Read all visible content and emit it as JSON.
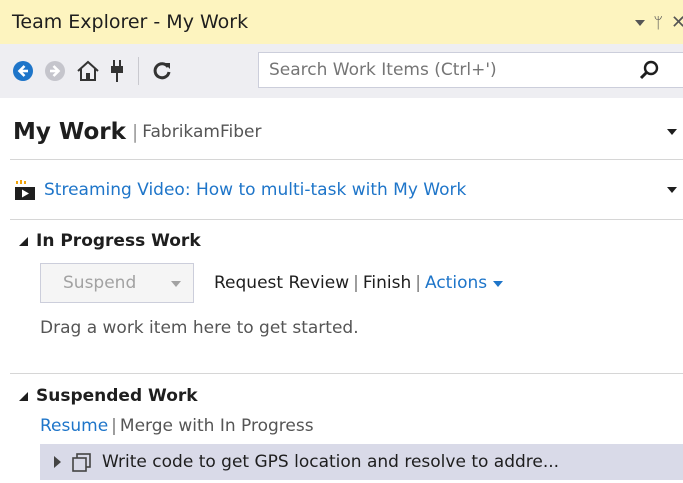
{
  "window": {
    "title": "Team Explorer - My Work",
    "pin_glyph": "ᛘ",
    "close_glyph": "✕"
  },
  "toolbar": {
    "search_placeholder": "Search Work Items (Ctrl+')",
    "icons": [
      "back-icon",
      "forward-icon",
      "home-icon",
      "connect-icon",
      "refresh-icon",
      "search-icon"
    ],
    "accent_color": "#1e75c9"
  },
  "header": {
    "title": "My Work",
    "separator": "|",
    "project": "FabrikamFiber"
  },
  "video": {
    "label": "Streaming Video: How to multi-task with My Work"
  },
  "in_progress": {
    "title": "In Progress Work",
    "suspend_label": "Suspend",
    "request_review": "Request Review",
    "finish": "Finish",
    "actions": "Actions",
    "separator": "|",
    "hint": "Drag a work item here to get started."
  },
  "suspended": {
    "title": "Suspended Work",
    "resume": "Resume",
    "merge": "Merge with In Progress",
    "separator": "|",
    "items": [
      {
        "label": "Write code to get GPS location and resolve to addre..."
      }
    ],
    "selected_row_color": "#d9dae8"
  }
}
